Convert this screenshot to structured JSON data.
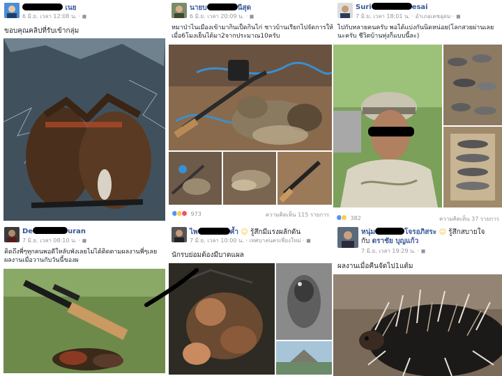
{
  "posts": [
    {
      "name_visible": "เนย",
      "meta": "6 มิ.ย. เวลา 12:08 น. · ",
      "caption": "ขอบคุณคลิปที่รับเข้ากลุ่ม"
    },
    {
      "name_visible": "นายบ",
      "name_visible_end": "นีสุด",
      "meta": "6 มิ.ย. เวลา 20:09 น. · ",
      "caption_line1": "หมาป่าไนเมืองเข้ามากินเป็ดกินไก่ ชาวบ้านเรียกไปจัดการให้",
      "caption_line2": "เมื่อ6โมงเย็นได้มา2จากประมาณ10ครับ",
      "reactions_count": "973",
      "comments": "ความคิดเห็น 115 รายการ"
    },
    {
      "name_visible": "Suri",
      "name_visible_end": "esai",
      "meta": "7 มิ.ย. เวลา 18:01 น. · อำเภอเดชอุดม · ",
      "caption_line1": "ไปกับหลายคนครับ พอได้แบ่งกันนิดหน่อย(โลกสวยผ่านเลย",
      "caption_line2": "นะครับ ชีวิตบ้านทุ่งก็แบบนี้ละ)",
      "reactions_count": "382",
      "comments": "ความคิดเห็น 37 รายการ"
    },
    {
      "name_visible": "De",
      "name_visible_end": "uran",
      "meta": "7 มิ.ย. เวลา 08:10 น. · ",
      "caption_line1": "คิดถึงพี่ๆทุกคนพอดีใหลับพังเลยไม่ได้ติดตามผลงานพี่ๆเลย",
      "caption_line2": "ผลงานเมื่อวานกับวันนี้ของผ"
    },
    {
      "name_visible": "ไพ",
      "name_visible_end": "ค้ำ",
      "feeling": " รู้สึกมีแรงผลักดัน",
      "meta": "7 มิ.ย. เวลา 10:00 น. · เทศบาลนครเชียงใหม่ · ",
      "caption": "นักรบย่อมต้องมีบาดแผล"
    },
    {
      "name_visible": "หนุ่ม",
      "name_visible_mid": "โจรอภิสระ",
      "feeling": " รู้สึกสบายใจ",
      "name_line2_prefix": "กับ ",
      "name_line2_friend": "ดราชัย บุญแก้ว",
      "meta": "7 มิ.ย. เวลา 19:29 น. · ",
      "caption": "ผลงานเมื่อคืนจัดไป1แต้ม"
    }
  ],
  "icons": {
    "privacy": "globe-icon",
    "emoji": "smiling-face-icon",
    "reactions": [
      "like-icon",
      "wow-icon",
      "love-icon"
    ]
  },
  "colors": {
    "link_blue": "#365899",
    "meta_gray": "#90949c",
    "like_blue": "#5890ff",
    "love_red": "#f25268",
    "wow_yellow": "#fbcd4b"
  }
}
